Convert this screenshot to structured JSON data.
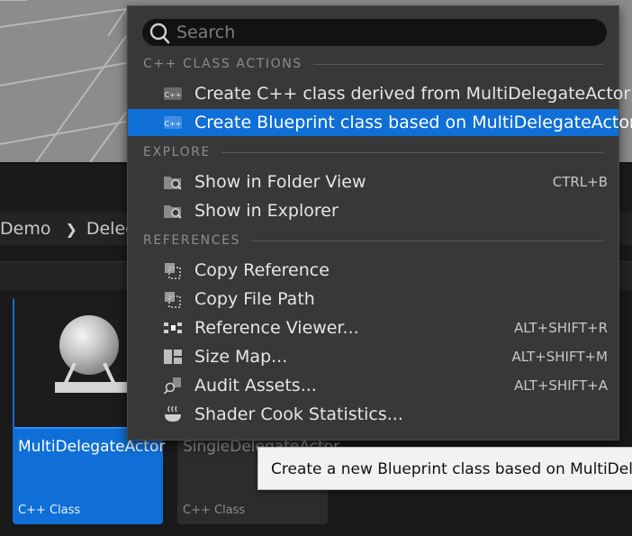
{
  "search": {
    "placeholder": "Search"
  },
  "menu": {
    "sections": [
      {
        "title": "C++ CLASS ACTIONS"
      },
      {
        "title": "EXPLORE"
      },
      {
        "title": "REFERENCES"
      }
    ],
    "items": [
      {
        "label": "Create C++ class derived from MultiDelegateActor",
        "icon": "cpp-class-icon",
        "shortcut": ""
      },
      {
        "label": "Create Blueprint class based on MultiDelegateActor",
        "icon": "cpp-class-icon",
        "shortcut": "",
        "selected": true
      },
      {
        "label": "Show in Folder View",
        "icon": "folder-search-icon",
        "shortcut": "CTRL+B"
      },
      {
        "label": "Show in Explorer",
        "icon": "folder-search-icon",
        "shortcut": ""
      },
      {
        "label": "Copy Reference",
        "icon": "copy-reference-icon",
        "shortcut": ""
      },
      {
        "label": "Copy File Path",
        "icon": "copy-file-path-icon",
        "shortcut": ""
      },
      {
        "label": "Reference Viewer...",
        "icon": "reference-viewer-icon",
        "shortcut": "ALT+SHIFT+R"
      },
      {
        "label": "Size Map...",
        "icon": "size-map-icon",
        "shortcut": "ALT+SHIFT+M"
      },
      {
        "label": "Audit Assets...",
        "icon": "audit-assets-icon",
        "shortcut": "ALT+SHIFT+A"
      },
      {
        "label": "Shader Cook Statistics...",
        "icon": "shader-stats-icon",
        "shortcut": ""
      }
    ]
  },
  "breadcrumb": {
    "items": [
      "Demo",
      "Deleg"
    ]
  },
  "assets": [
    {
      "name": "MultiDelegateActor",
      "type": "C++ Class",
      "selected": true
    },
    {
      "name": "SingleDelegateActor",
      "type": "C++ Class",
      "selected": false
    }
  ],
  "tooltip": {
    "text": "Create a new Blueprint class based on MultiDelegateActor"
  },
  "colors": {
    "accent": "#0f6fd6",
    "menu_bg": "#383838",
    "tooltip_bg": "#f2f2f2"
  }
}
